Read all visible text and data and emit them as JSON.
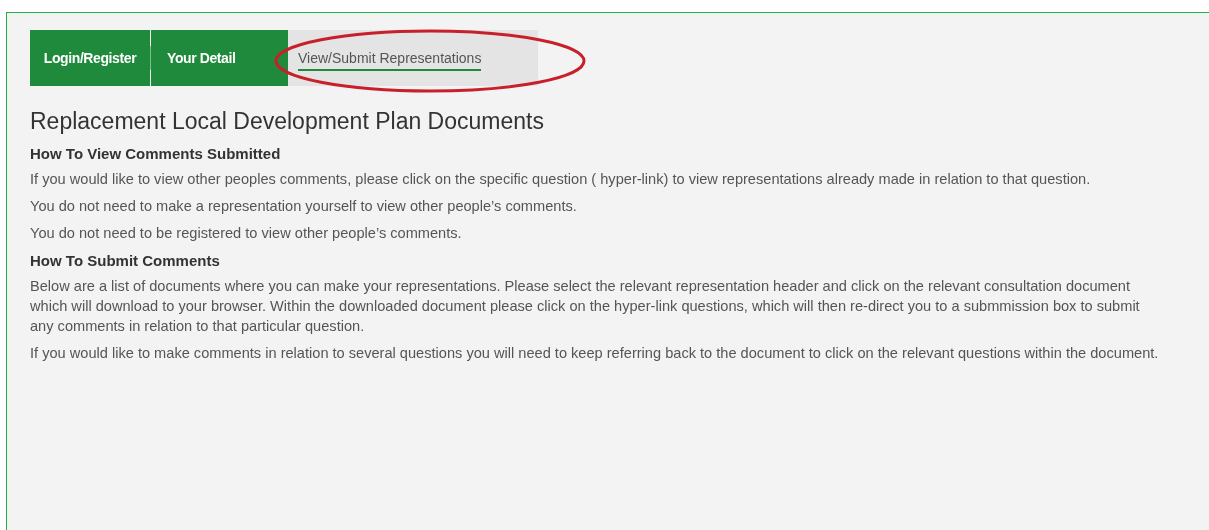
{
  "tabs": [
    {
      "label": "Login/Register",
      "selected": false
    },
    {
      "label": "Your Detail",
      "selected": false
    },
    {
      "label": "View/Submit Representations",
      "selected": true
    }
  ],
  "page_title": "Replacement Local Development Plan Documents",
  "sections": [
    {
      "heading": "How To View Comments Submitted",
      "paragraphs": [
        "If you would like to view other peoples comments, please click on the specific question ( hyper-link) to view representations already made in relation to that question.",
        "You do not need to make a representation yourself to view other people’s comments.",
        "You do not need to be registered to view other people’s comments."
      ]
    },
    {
      "heading": "How To Submit Comments",
      "paragraphs": [
        "Below are a list of documents where you can make your representations. Please select the relevant representation header and click on the relevant consultation document which will download to your browser. Within the downloaded document please click on the hyper-link questions, which will then re-direct you to a submmission box to submit any comments in relation to that particular question.",
        "If you would like to make comments in relation to several questions you will need to keep referring back to the document to click on the relevant questions within the document."
      ]
    }
  ]
}
